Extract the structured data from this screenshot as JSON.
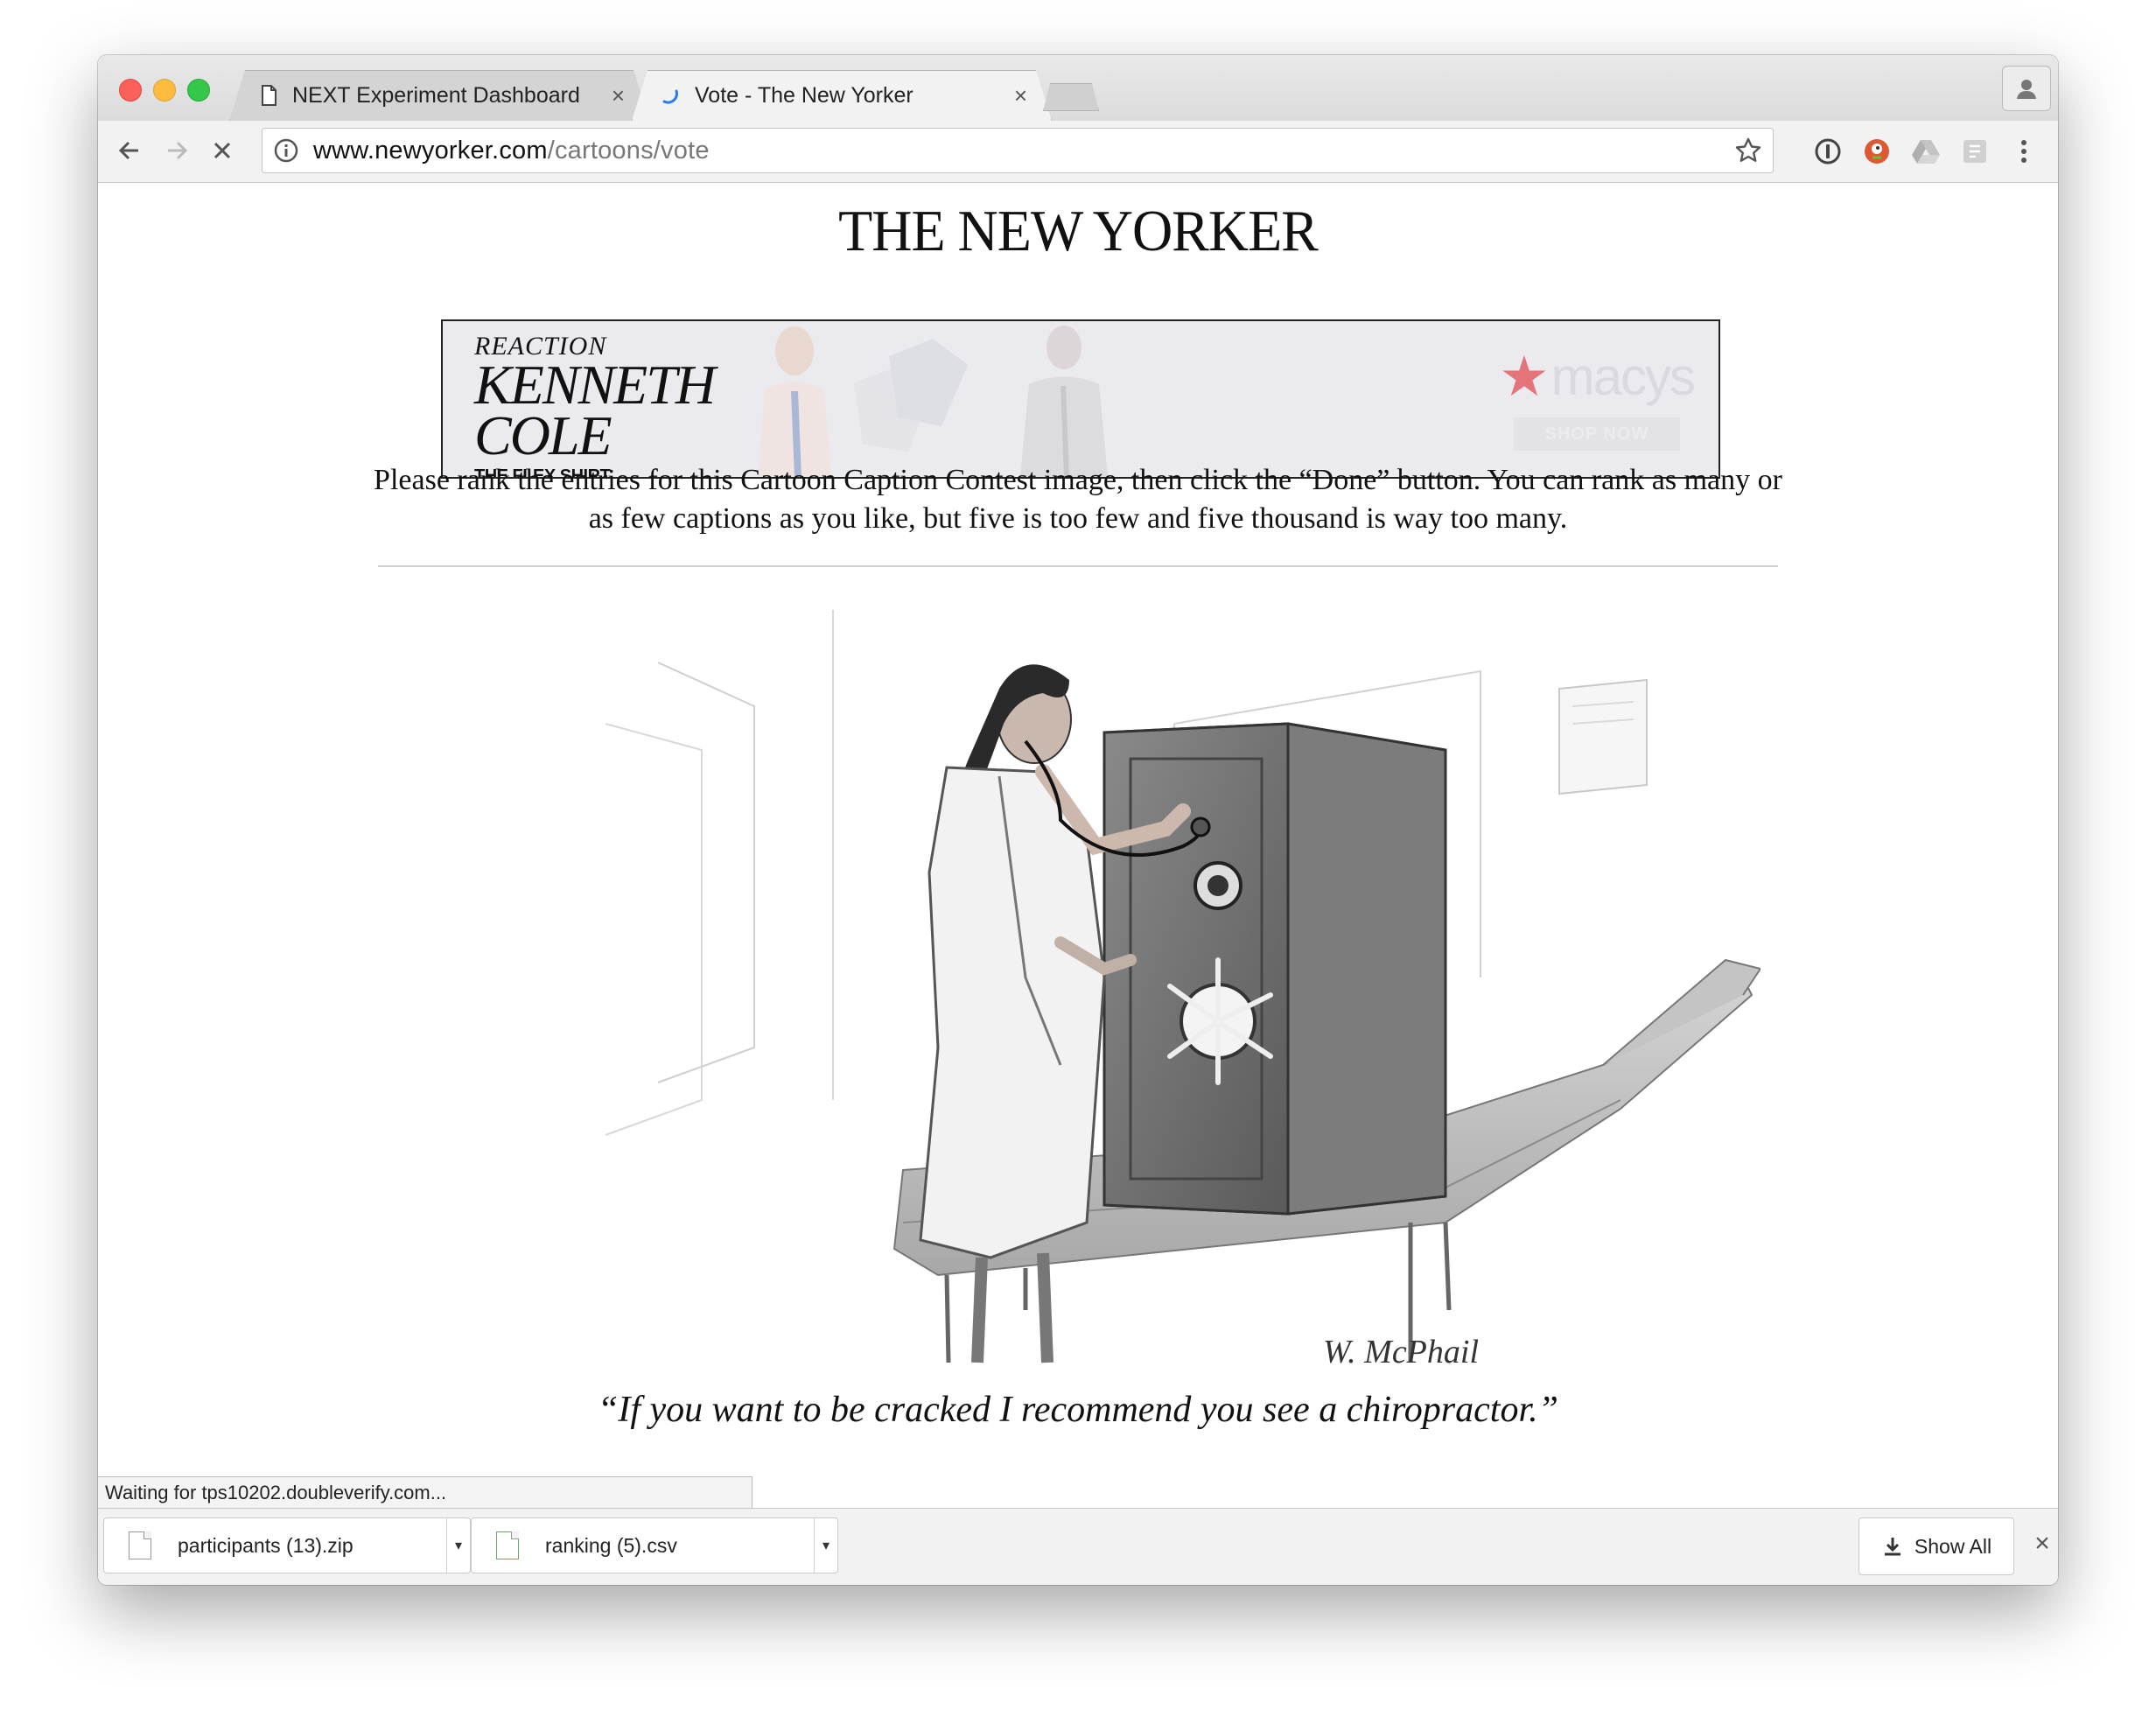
{
  "browser": {
    "tabs": [
      {
        "label": "NEXT Experiment Dashboard",
        "close": "×",
        "active": false
      },
      {
        "label": "Vote - The New Yorker",
        "close": "×",
        "active": true
      }
    ],
    "url_host": "www.newyorker.com",
    "url_path": "/cartoons/vote",
    "icons": {
      "back": "arrow-left-icon",
      "forward": "arrow-right-icon",
      "stop": "stop-loading-icon",
      "info": "info-icon",
      "bookmark": "star-icon",
      "menu": "more-vert-icon"
    }
  },
  "page": {
    "masthead": "THE NEW YORKER",
    "ad": {
      "reaction": "REACTION",
      "brand_line1": "KENNETH",
      "brand_line2": "COLE",
      "tagline": "THE FLEX SHIRT",
      "retailer": "macys",
      "cta": "SHOP NOW",
      "accent_color": "#e4737a"
    },
    "instructions": "Please rank the entries for this Cartoon Caption Contest image, then click the “Done” button. You can rank as many or as few captions as you like, but five is too few and five thousand is way too many.",
    "cartoon_signature": "W. McPhail",
    "caption": "“If you want to be cracked I recommend you see a chiropractor.”"
  },
  "status": {
    "text": "Waiting for tps10202.doubleverify.com..."
  },
  "downloads": {
    "items": [
      {
        "name": "participants (13).zip"
      },
      {
        "name": "ranking (5).csv"
      }
    ],
    "show_all": "Show All",
    "close": "×"
  }
}
